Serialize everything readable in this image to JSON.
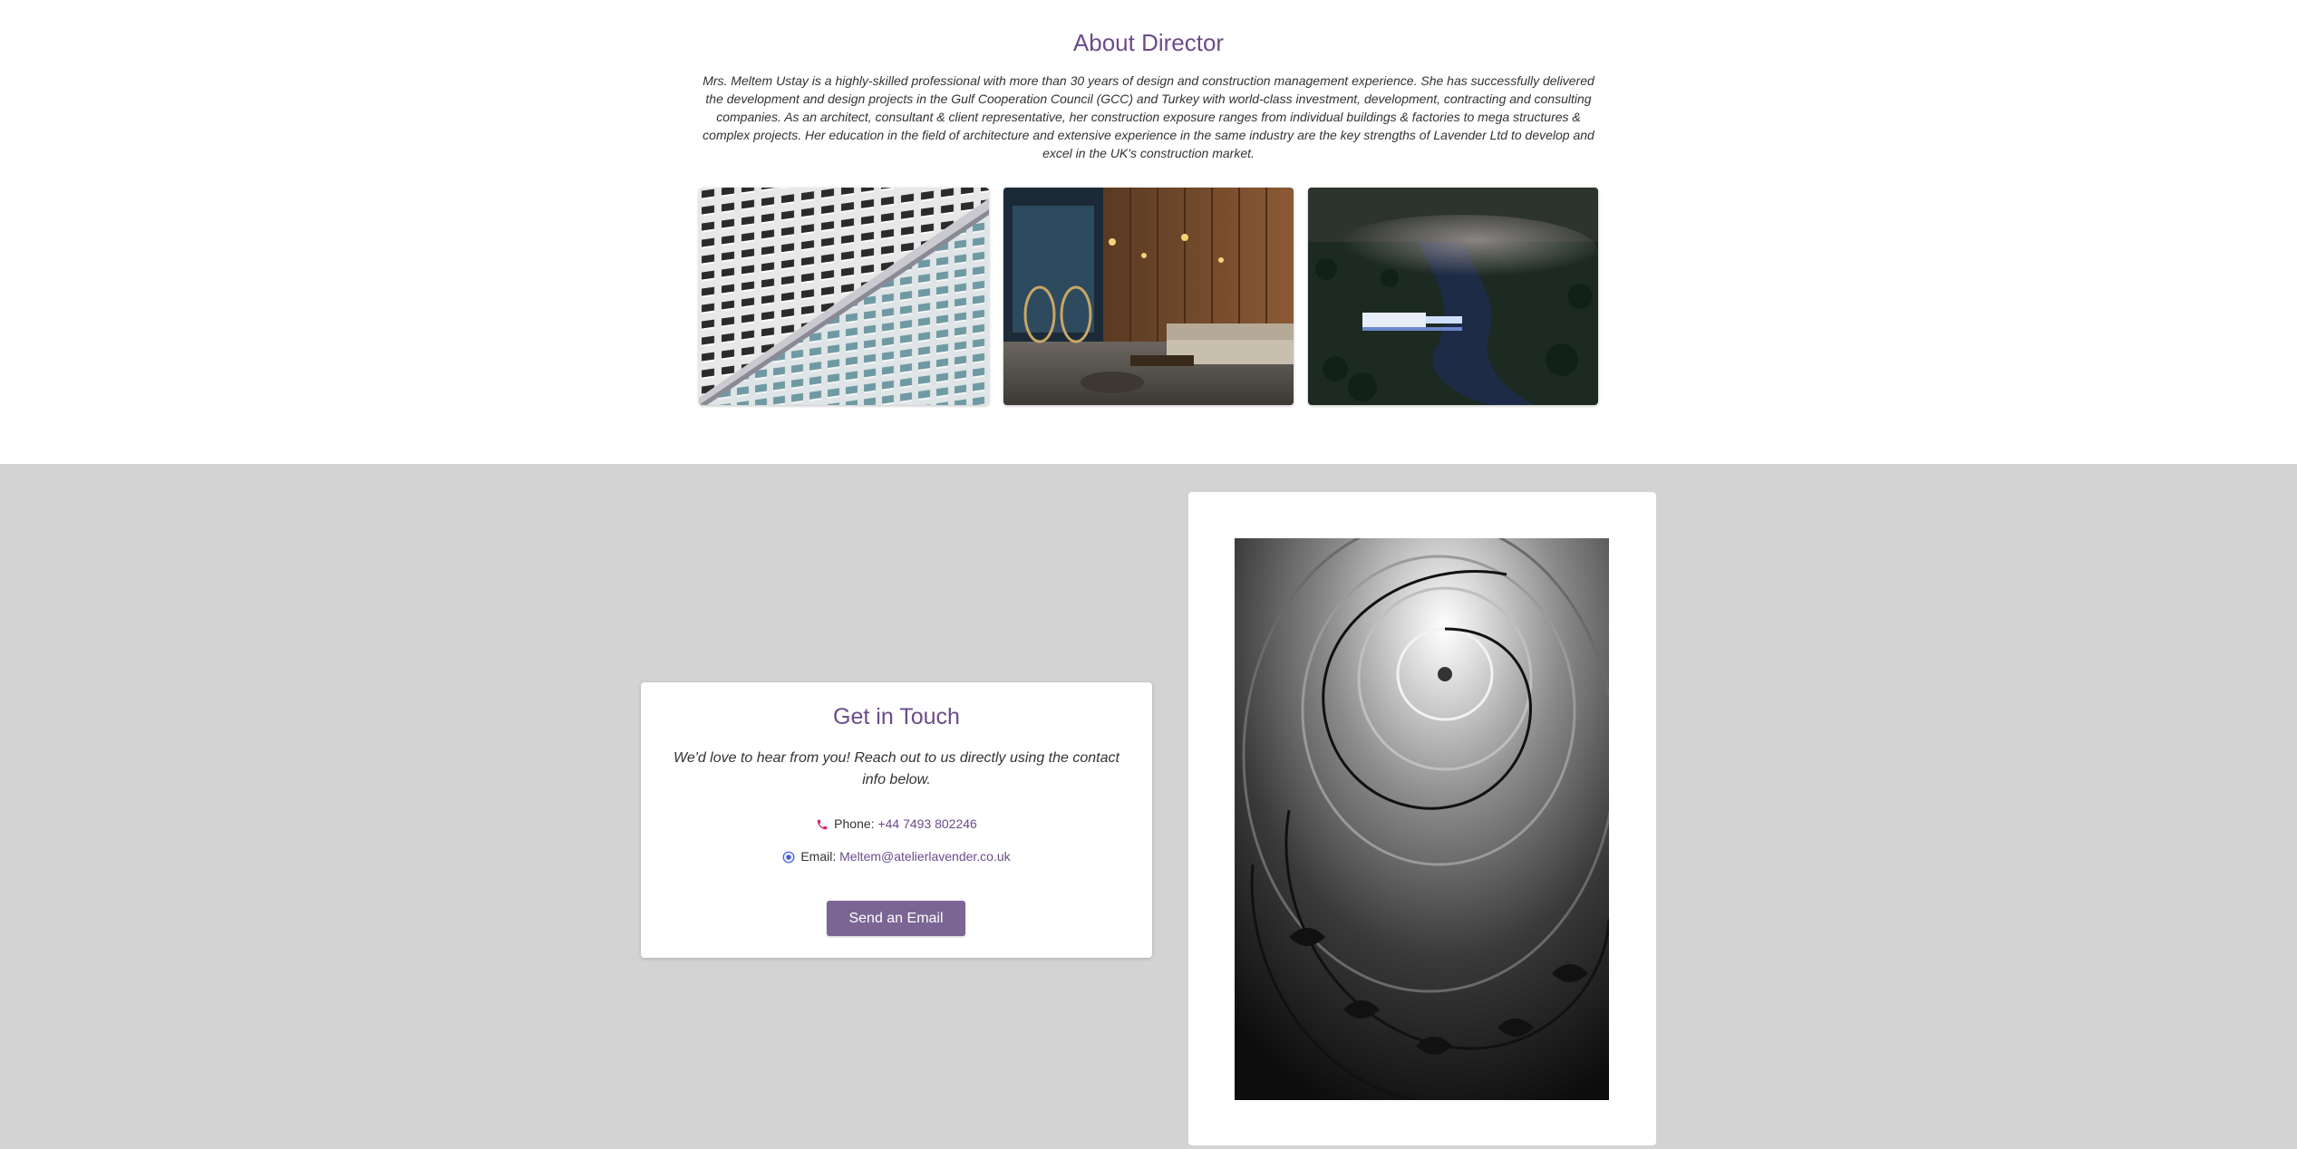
{
  "about": {
    "title": "About Director",
    "text": "Mrs. Meltem Ustay is a highly-skilled professional with more than 30 years of design and construction management experience. She has successfully delivered the development and design projects in the Gulf Cooperation Council (GCC) and Turkey with world-class investment, development, contracting and consulting companies. As an architect, consultant & client representative, her construction exposure ranges from individual buildings & factories to mega structures & complex projects. Her education in the field of architecture and extensive experience in the same industry are the key strengths of Lavender Ltd to develop and excel in the UK's construction market."
  },
  "gallery": [
    {
      "icon": "building-facade-photo"
    },
    {
      "icon": "interior-lounge-photo"
    },
    {
      "icon": "forest-river-aerial-photo"
    }
  ],
  "contact": {
    "title": "Get in Touch",
    "intro": "We'd love to hear from you! Reach out to us directly using the contact info below.",
    "phone_label": "Phone:",
    "phone_value": "+44 7493 802246",
    "email_label": "Email:",
    "email_value": "Meltem@atelierlavender.co.uk",
    "button_label": "Send an Email"
  },
  "side_photo": {
    "icon": "spiral-staircase-photo"
  },
  "colors": {
    "accent": "#6b4c8a",
    "button": "#7a6594",
    "section_bg": "#d3d3d3",
    "phone_icon": "#d6246e",
    "email_icon": "#3b5bdb"
  }
}
